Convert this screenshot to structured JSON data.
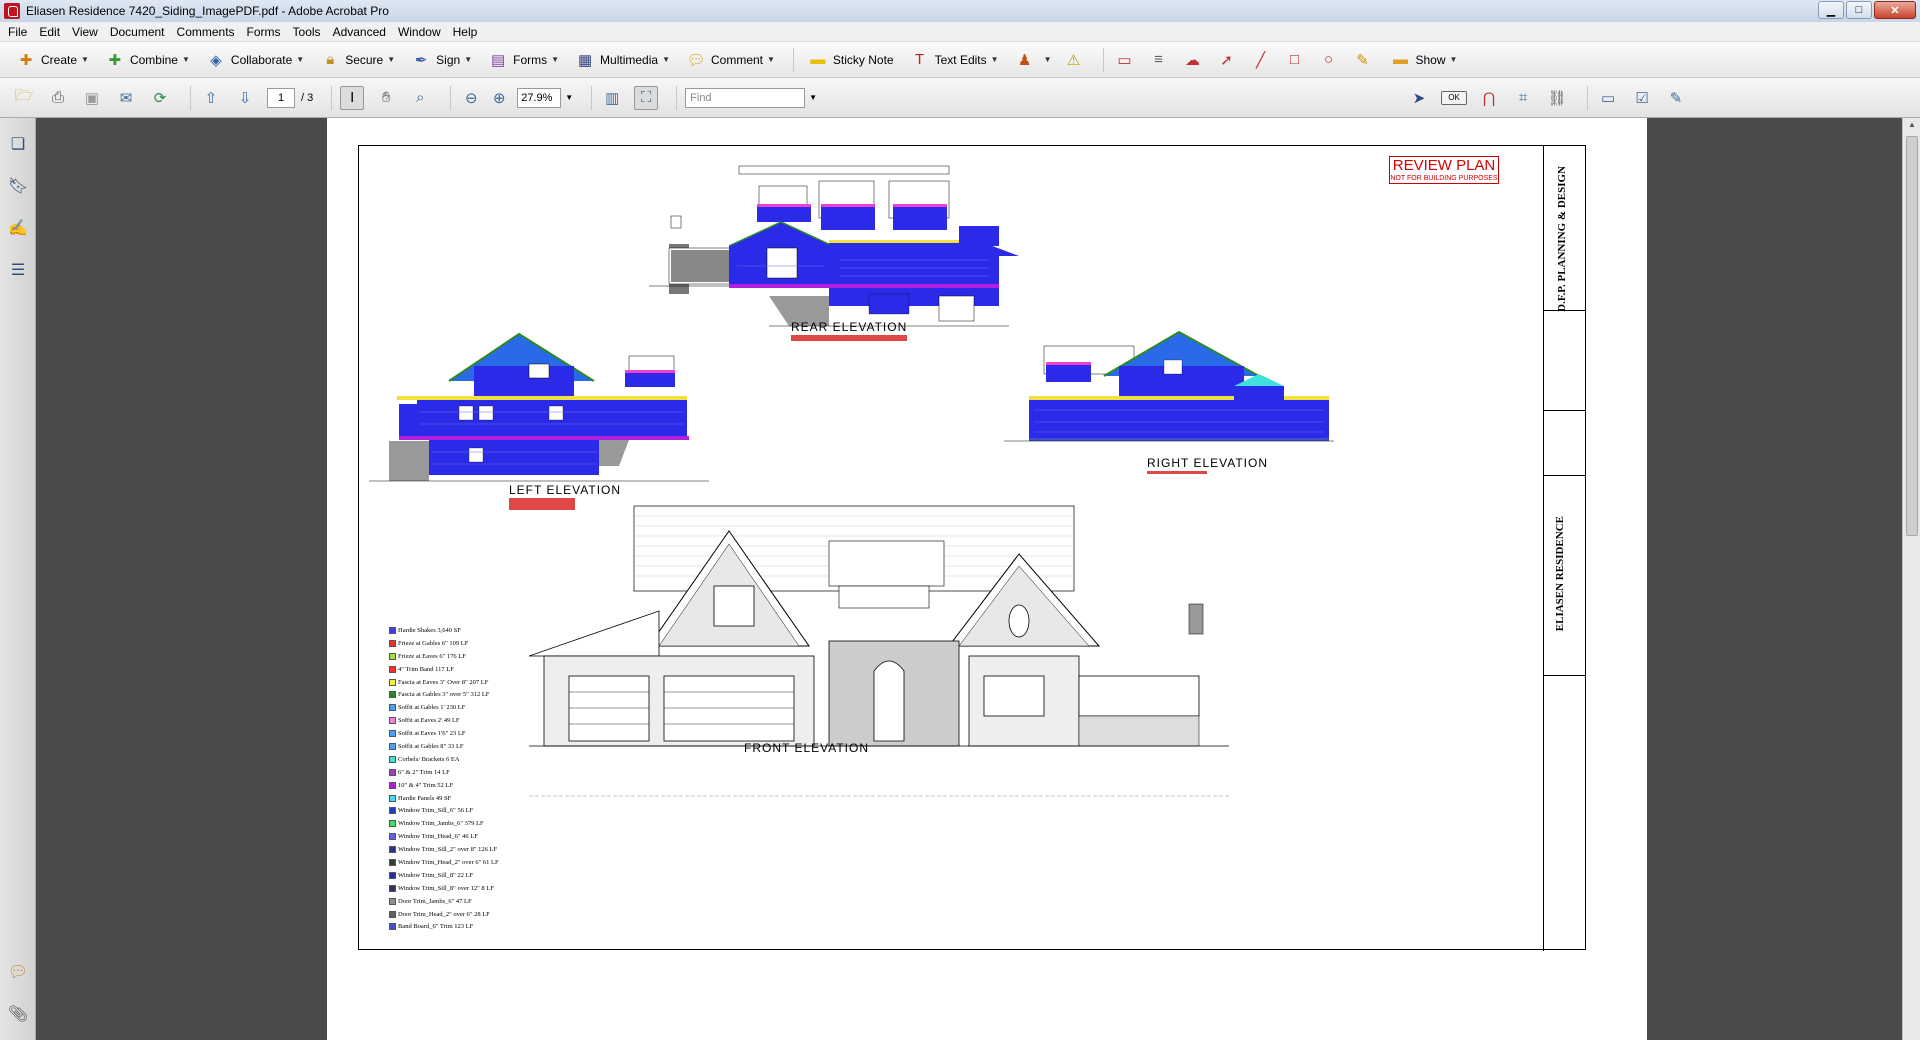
{
  "window": {
    "title": "Eliasen Residence 7420_Siding_ImagePDF.pdf - Adobe Acrobat Pro"
  },
  "menu": [
    "File",
    "Edit",
    "View",
    "Document",
    "Comments",
    "Forms",
    "Tools",
    "Advanced",
    "Window",
    "Help"
  ],
  "toolbar1": {
    "create": "Create",
    "combine": "Combine",
    "collaborate": "Collaborate",
    "secure": "Secure",
    "sign": "Sign",
    "forms": "Forms",
    "multimedia": "Multimedia",
    "comment": "Comment",
    "sticky_note": "Sticky Note",
    "text_edits": "Text Edits",
    "show": "Show"
  },
  "toolbar2": {
    "page_current": "1",
    "page_total": "/ 3",
    "zoom": "27.9%",
    "find_placeholder": "Find",
    "ok": "OK"
  },
  "drawing": {
    "review_title": "REVIEW PLAN",
    "review_sub": "NOT FOR BUILDING PURPOSES",
    "rear_label": "REAR ELEVATION",
    "left_label": "LEFT ELEVATION",
    "right_label": "RIGHT ELEVATION",
    "front_label": "FRONT ELEVATION",
    "firm_name": "D.F.P. PLANNING & DESIGN",
    "project_name": "ELIASEN RESIDENCE",
    "legend": [
      {
        "label": "Hardie Shakes  3,640 SF",
        "color": "#3a3aef"
      },
      {
        "label": "Frieze at Gables 6\"  109 LF",
        "color": "#f03030"
      },
      {
        "label": "Frieze at Eaves 6\"  176 LF",
        "color": "#9ae040"
      },
      {
        "label": "4\" Trim Band  117 LF",
        "color": "#f03030"
      },
      {
        "label": "Fascia at Eaves 3\" Over 8\"  207 LF",
        "color": "#f6f040"
      },
      {
        "label": "Fascia at Gables 3\" over 5\"  312 LF",
        "color": "#2a8a2a"
      },
      {
        "label": "Soffit at Gables 1'  230 LF",
        "color": "#4aa0f0"
      },
      {
        "label": "Soffit at Eaves 2'  49 LF",
        "color": "#f080e0"
      },
      {
        "label": "Soffit at Eaves 1'6\"  23 LF",
        "color": "#4aa0f0"
      },
      {
        "label": "Soffit at Gables 8\"  33 LF",
        "color": "#4aa0f0"
      },
      {
        "label": "Corbels/ Brackets  6 EA",
        "color": "#40e0e0"
      },
      {
        "label": "6\" & 2\" Trim  14 LF",
        "color": "#9a40c0"
      },
      {
        "label": "10\" & 4\" Trim  52 LF",
        "color": "#b020e0"
      },
      {
        "label": "Hardie Panels  49 SF",
        "color": "#40e0f0"
      },
      {
        "label": "Window Trim_Sill_6\"  56 LF",
        "color": "#2040c0"
      },
      {
        "label": "Window Trim_Jambs_6\"  379 LF",
        "color": "#40e060"
      },
      {
        "label": "Window Trim_Head_6\"  46 LF",
        "color": "#6060f0"
      },
      {
        "label": "Window Trim_Sill_2\" over 8\"  126 LF",
        "color": "#303090"
      },
      {
        "label": "Window Trim_Head_2\" over 6\"  61 LF",
        "color": "#304030"
      },
      {
        "label": "Window Trim_Sill_8\"  22 LF",
        "color": "#2030a0"
      },
      {
        "label": "Window Trim_Sill_8\" over 12\"  8 LF",
        "color": "#303060"
      },
      {
        "label": "Door Trim_Jambs_6\"  47 LF",
        "color": "#909090"
      },
      {
        "label": "Door Trim_Head_2\" over 6\"  28 LF",
        "color": "#606060"
      },
      {
        "label": "Band Board_6\" Trim  123 LF",
        "color": "#4050d0"
      }
    ]
  }
}
